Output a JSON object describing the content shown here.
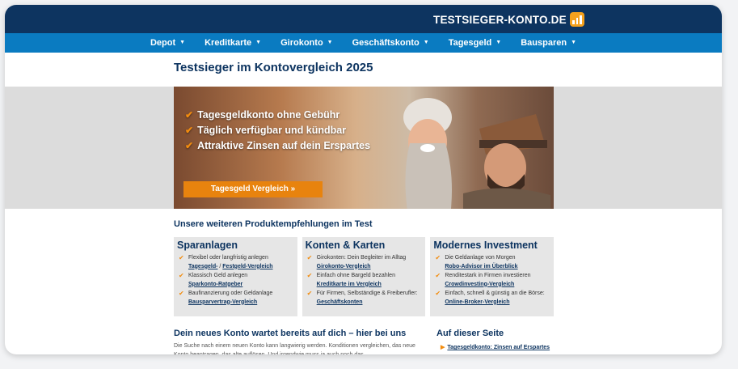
{
  "brand": {
    "name": "TESTSIEGER-KONTO.DE",
    "logo_color": "#f5a11c"
  },
  "nav": {
    "items": [
      "Depot",
      "Kreditkarte",
      "Girokonto",
      "Geschäftskonto",
      "Tagesgeld",
      "Bausparen"
    ]
  },
  "page": {
    "title": "Testsieger im Kontovergleich 2025"
  },
  "hero": {
    "bullets": [
      "Tagesgeldkonto ohne Gebühr",
      "Täglich verfügbar und kündbar",
      "Attraktive Zinsen auf dein Erspartes"
    ],
    "button": "Tagesgeld Vergleich »"
  },
  "products": {
    "title": "Unsere weiteren Produktempfehlungen im Test",
    "cards": [
      {
        "title": "Sparanlagen",
        "items": [
          {
            "text": "Flexibel oder langfristig anlegen",
            "links": [
              "Tagesgeld-",
              " / ",
              "Festgeld-Vergleich"
            ]
          },
          {
            "text": "Klassisch Geld anlegen",
            "link": "Sparkonto-Ratgeber"
          },
          {
            "text": "Baufinanzierung oder Geldanlage",
            "link": "Bausparvertrag-Vergleich"
          }
        ]
      },
      {
        "title": "Konten & Karten",
        "items": [
          {
            "text": "Girokonten: Dein Begleiter im Alltag",
            "link": "Girokonto-Vergleich"
          },
          {
            "text": "Einfach ohne Bargeld bezahlen",
            "link": "Kreditkarte im Vergleich"
          },
          {
            "text": "Für Firmen, Selbständige & Freiberufler:",
            "link": "Geschäftskonten"
          }
        ]
      },
      {
        "title": "Modernes Investment",
        "items": [
          {
            "text": "Die Geldanlage von Morgen",
            "link": "Robo-Advisor im Überblick"
          },
          {
            "text": "Renditestark in Firmen investieren",
            "link": "Crowdinvesting-Vergleich"
          },
          {
            "text": "Einfach, schnell & günstig an die Börse:",
            "link": "Online-Broker-Vergleich"
          }
        ]
      }
    ]
  },
  "bottom": {
    "title": "Dein neues Konto wartet bereits auf dich – hier bei uns",
    "text": "Die Suche nach einem neuen Konto kann langwierig werden. Konditionen vergleichen, das neue Konto beantragen, das alte auflösen. Und irgendwie muss ja auch noch das",
    "aside_title": "Auf dieser Seite",
    "aside_link": "Tagesgeldkonto: Zinsen auf Erspartes"
  }
}
